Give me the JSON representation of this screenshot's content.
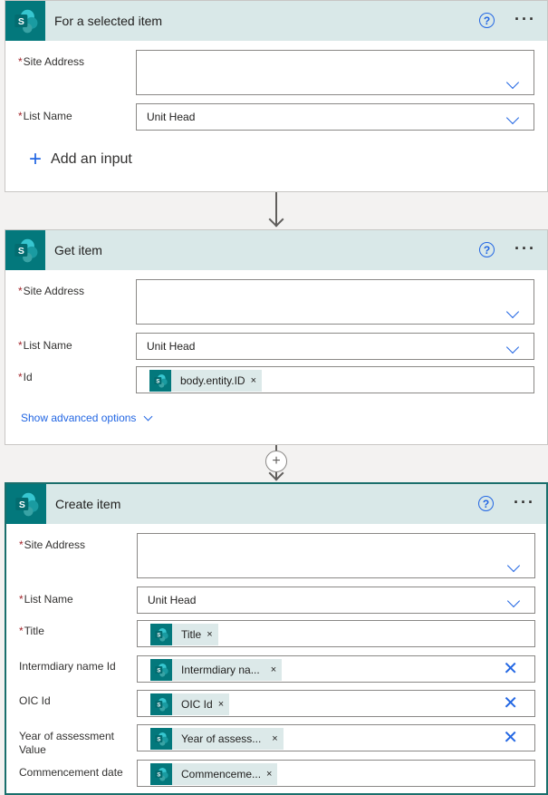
{
  "cards": [
    {
      "title": "For a selected item",
      "site_address_label": "Site Address",
      "list_name_label": "List Name",
      "list_name_value": "Unit Head",
      "add_input_label": "Add an input"
    },
    {
      "title": "Get item",
      "site_address_label": "Site Address",
      "list_name_label": "List Name",
      "list_name_value": "Unit Head",
      "id_label": "Id",
      "id_token": "body.entity.ID",
      "advanced_label": "Show advanced options"
    },
    {
      "title": "Create item",
      "site_address_label": "Site Address",
      "list_name_label": "List Name",
      "list_name_value": "Unit Head",
      "fields": [
        {
          "label": "Title",
          "token": "Title",
          "required": true
        },
        {
          "label": "Intermdiary name Id",
          "token": "Intermdiary na...",
          "required": false
        },
        {
          "label": "OIC Id",
          "token": "OIC Id",
          "required": false
        },
        {
          "label": "Year of assessment Value",
          "token": "Year of assess...",
          "required": false
        },
        {
          "label": "Commencement date",
          "token": "Commenceme...",
          "required": false
        }
      ]
    }
  ],
  "icons": {
    "help": "?",
    "more": "···",
    "token_remove": "×",
    "field_clear": "✕",
    "add": "+",
    "insert_step": "+",
    "required_marker": "*"
  },
  "colors": {
    "brand": "#03787c",
    "header_bg": "#d9e8e8",
    "accent": "#2266e3",
    "required": "#a4262c"
  }
}
